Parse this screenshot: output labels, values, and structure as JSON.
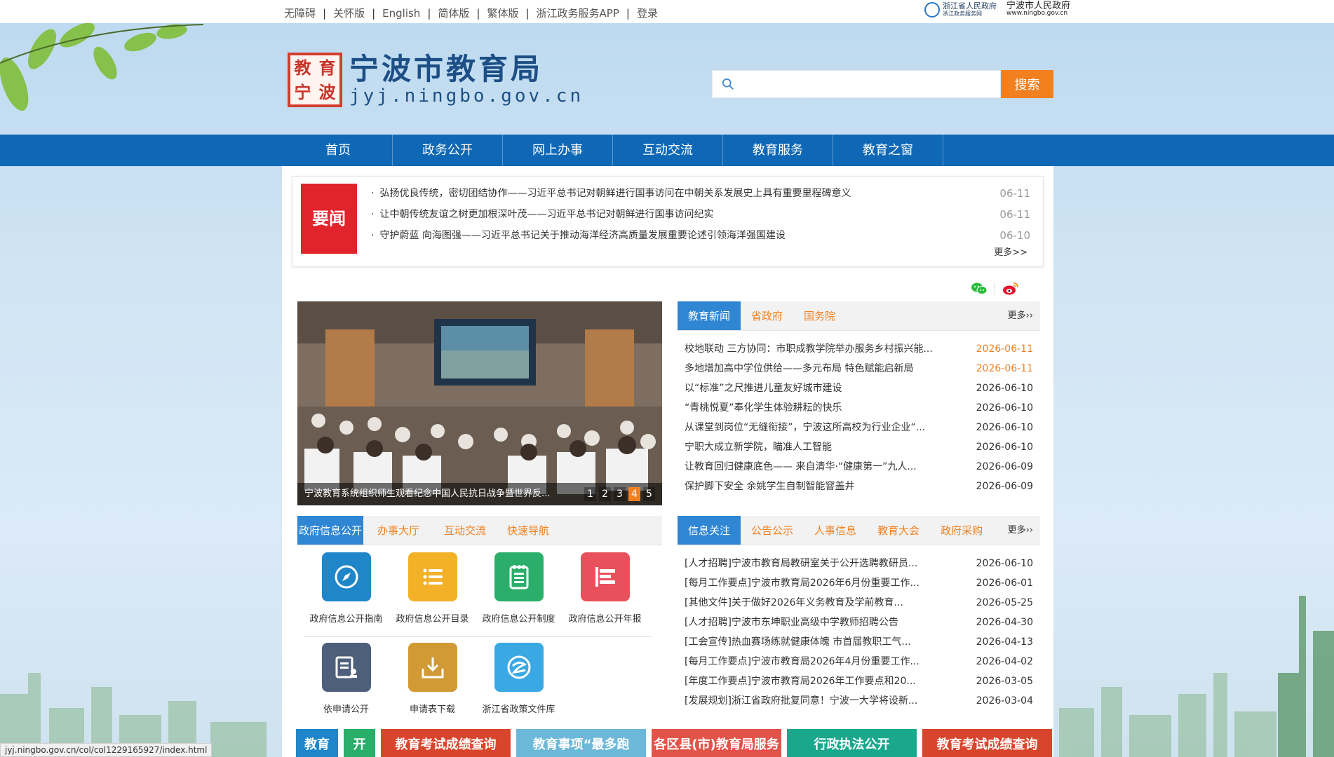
{
  "topbar": {
    "links": [
      "无障碍",
      "关怀版",
      "English",
      "简体版",
      "繁体版",
      "浙江政务服务APP",
      "登录"
    ],
    "gov_logo_zj": {
      "line1": "浙江省人民政府",
      "line2": "浙江政务服务网"
    },
    "gov_logo_nb": {
      "line1": "宁波市人民政府",
      "line2": "www.ningbo.gov.cn"
    }
  },
  "header": {
    "seal_chars": [
      "教",
      "育",
      "宁",
      "波"
    ],
    "site_name": "宁波市教育局",
    "site_url": "jyj.ningbo.gov.cn",
    "search_button": "搜索"
  },
  "nav": [
    "首页",
    "政务公开",
    "网上办事",
    "互动交流",
    "教育服务",
    "教育之窗"
  ],
  "headline": {
    "badge": "要闻",
    "items": [
      {
        "title": "弘扬优良传统，密切团结协作——习近平总书记对朝鲜进行国事访问在中朝关系发展史上具有重要里程碑意义",
        "date": "06-11"
      },
      {
        "title": "让中朝传统友谊之树更加根深叶茂——习近平总书记对朝鲜进行国事访问纪实",
        "date": "06-11"
      },
      {
        "title": "守护蔚蓝 向海图强——习近平总书记关于推动海洋经济高质量发展重要论述引领海洋强国建设",
        "date": "06-10"
      }
    ],
    "more": "更多>>"
  },
  "carousel": {
    "caption": "宁波教育系统组织师生观看纪念中国人民抗日战争暨世界反...",
    "pages": [
      "1",
      "2",
      "3",
      "4",
      "5"
    ],
    "active_page": "4"
  },
  "news_panel": {
    "tabs": [
      "教育新闻",
      "省政府",
      "国务院"
    ],
    "more": "更多››",
    "items": [
      {
        "title": "校地联动 三方协同：市职成教学院举办服务乡村振兴能...",
        "date": "2026-06-11",
        "hot": true
      },
      {
        "title": "多地增加高中学位供给——多元布局 特色赋能启新局",
        "date": "2026-06-11",
        "hot": true
      },
      {
        "title": "以“标准”之尺推进儿童友好城市建设",
        "date": "2026-06-10",
        "hot": false
      },
      {
        "title": "“青桃悦夏”奉化学生体验耕耘的快乐",
        "date": "2026-06-10",
        "hot": false
      },
      {
        "title": "从课堂到岗位“无缝衔接”，宁波这所高校为行业企业“...",
        "date": "2026-06-10",
        "hot": false
      },
      {
        "title": "宁职大成立新学院，瞄准人工智能",
        "date": "2026-06-10",
        "hot": false
      },
      {
        "title": "让教育回归健康底色—— 来自清华·“健康第一”九人...",
        "date": "2026-06-09",
        "hot": false
      },
      {
        "title": "保护脚下安全 余姚学生自制智能窨盖井",
        "date": "2026-06-09",
        "hot": false
      }
    ]
  },
  "gov_panel": {
    "tabs": [
      "政府信息公开",
      "办事大厅",
      "互动交流",
      "快速导航"
    ],
    "icons": [
      {
        "label": "政府信息公开指南",
        "icon": "compass-icon",
        "color": "#1e86c9"
      },
      {
        "label": "政府信息公开目录",
        "icon": "list-icon",
        "color": "#f2b127"
      },
      {
        "label": "政府信息公开制度",
        "icon": "clipboard-icon",
        "color": "#2aae6a"
      },
      {
        "label": "政府信息公开年报",
        "icon": "report-icon",
        "color": "#e8505b"
      },
      {
        "label": "依申请公开",
        "icon": "apply-form-icon",
        "color": "#4d5f7a"
      },
      {
        "label": "申请表下载",
        "icon": "download-tray-icon",
        "color": "#d29a35"
      },
      {
        "label": "浙江省政策文件库",
        "icon": "zj-policy-icon",
        "color": "#3aa8e3"
      }
    ]
  },
  "info_panel": {
    "tabs": [
      "信息关注",
      "公告公示",
      "人事信息",
      "教育大会",
      "政府采购"
    ],
    "more": "更多››",
    "items": [
      {
        "title": "[人才招聘]宁波市教育局教研室关于公开选聘教研员...",
        "date": "2026-06-10"
      },
      {
        "title": "[每月工作要点]宁波市教育局2026年6月份重要工作...",
        "date": "2026-06-01"
      },
      {
        "title": "[其他文件]关于做好2026年义务教育及学前教育...",
        "date": "2026-05-25"
      },
      {
        "title": "[人才招聘]宁波市东坤职业高级中学教师招聘公告",
        "date": "2026-04-30"
      },
      {
        "title": "[工会宣传]热血赛场练就健康体魄 市首届教职工气...",
        "date": "2026-04-13"
      },
      {
        "title": "[每月工作要点]宁波市教育局2026年4月份重要工作...",
        "date": "2026-04-02"
      },
      {
        "title": "[年度工作要点]宁波市教育局2026年工作要点和20...",
        "date": "2026-03-05"
      },
      {
        "title": "[发展规划]浙江省政府批复同意！宁波一大学将设新...",
        "date": "2026-03-04"
      }
    ]
  },
  "banners": [
    {
      "text": "教育",
      "color": "#1e86c9"
    },
    {
      "text": "开",
      "color": "#2aae6a"
    },
    {
      "text": "教育考试成绩查询",
      "color": "#d9452c"
    },
    {
      "text": "教育事项“最多跑",
      "color": "#6cb8d9"
    },
    {
      "text": "各区县(市)教育局服务热线",
      "color": "#e2534a"
    },
    {
      "text": "行政执法公开",
      "color": "#19a88c"
    },
    {
      "text": "教育考试成绩查询",
      "color": "#d9452c"
    }
  ],
  "status_url": "jyj.ningbo.gov.cn/col/col1229165927/index.html"
}
